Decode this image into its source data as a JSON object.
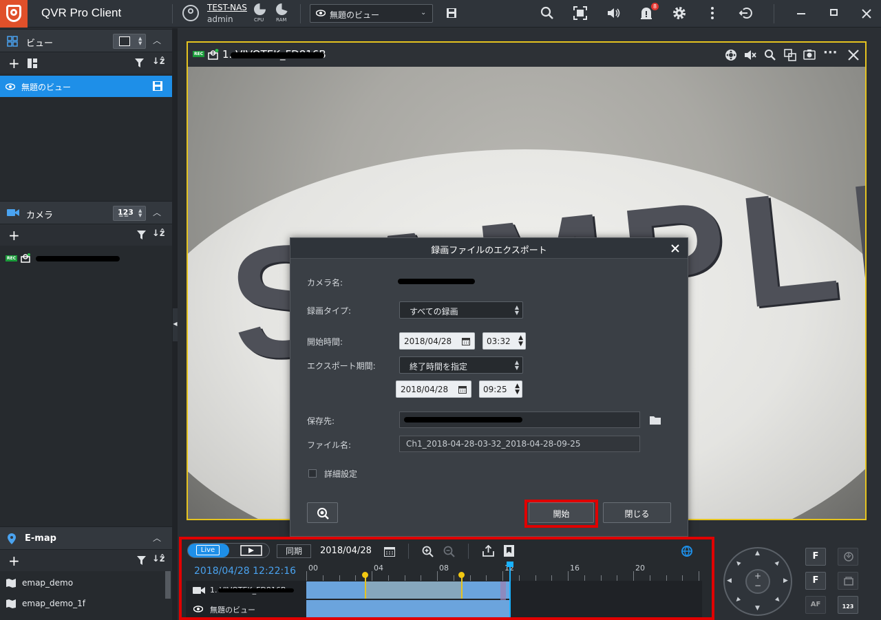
{
  "app": {
    "title": "QVR Pro Client",
    "nas_name": "TEST-NAS",
    "user": "admin",
    "cpu_label": "CPU",
    "ram_label": "RAM",
    "current_view": "無題のビュー",
    "alert_count": "8"
  },
  "views_panel": {
    "title": "ビュー",
    "items": [
      {
        "label": "無題のビュー"
      }
    ]
  },
  "camera_panel": {
    "title": "カメラ",
    "rec_tag": "REC"
  },
  "emap_panel": {
    "title": "E-map",
    "items": [
      {
        "label": "emap_demo"
      },
      {
        "label": "emap_demo_1f"
      }
    ]
  },
  "camera_view": {
    "rec_tag": "REC",
    "title": "1. VIVOTEK_FD816B",
    "watermark": "SAMPLE"
  },
  "export_dialog": {
    "title": "録画ファイルのエクスポート",
    "camera_label": "カメラ名:",
    "record_type_label": "録画タイプ:",
    "record_type_value": "すべての録画",
    "start_label": "開始時間:",
    "start_date": "2018/04/28",
    "start_time": "03:32",
    "period_label": "エクスポート期間:",
    "period_value": "終了時間を指定",
    "end_date": "2018/04/28",
    "end_time": "09:25",
    "save_label": "保存先:",
    "filename_label": "ファイル名:",
    "filename_value": "Ch1_2018-04-28-03-32_2018-04-28-09-25",
    "advanced_label": "詳細設定",
    "start_button": "開始",
    "close_button": "閉じる"
  },
  "timeline": {
    "live_label": "Live",
    "sync_label": "同期",
    "date": "2018/04/28",
    "current_time": "2018/04/28 12:22:16",
    "ticks": [
      "00",
      "04",
      "08",
      "12",
      "16",
      "20"
    ],
    "rows": [
      {
        "label": "1. VIVOTEK_FD816B"
      },
      {
        "label": "無題のビュー"
      }
    ]
  },
  "ptz": {
    "focus_near": "F",
    "focus_far": "F",
    "af_label": "AF",
    "preset_label": "123"
  },
  "colors": {
    "accent": "#1e8fe8",
    "highlight": "#e00000",
    "frame": "#e6c41f",
    "title_bar": "#2f343a"
  }
}
